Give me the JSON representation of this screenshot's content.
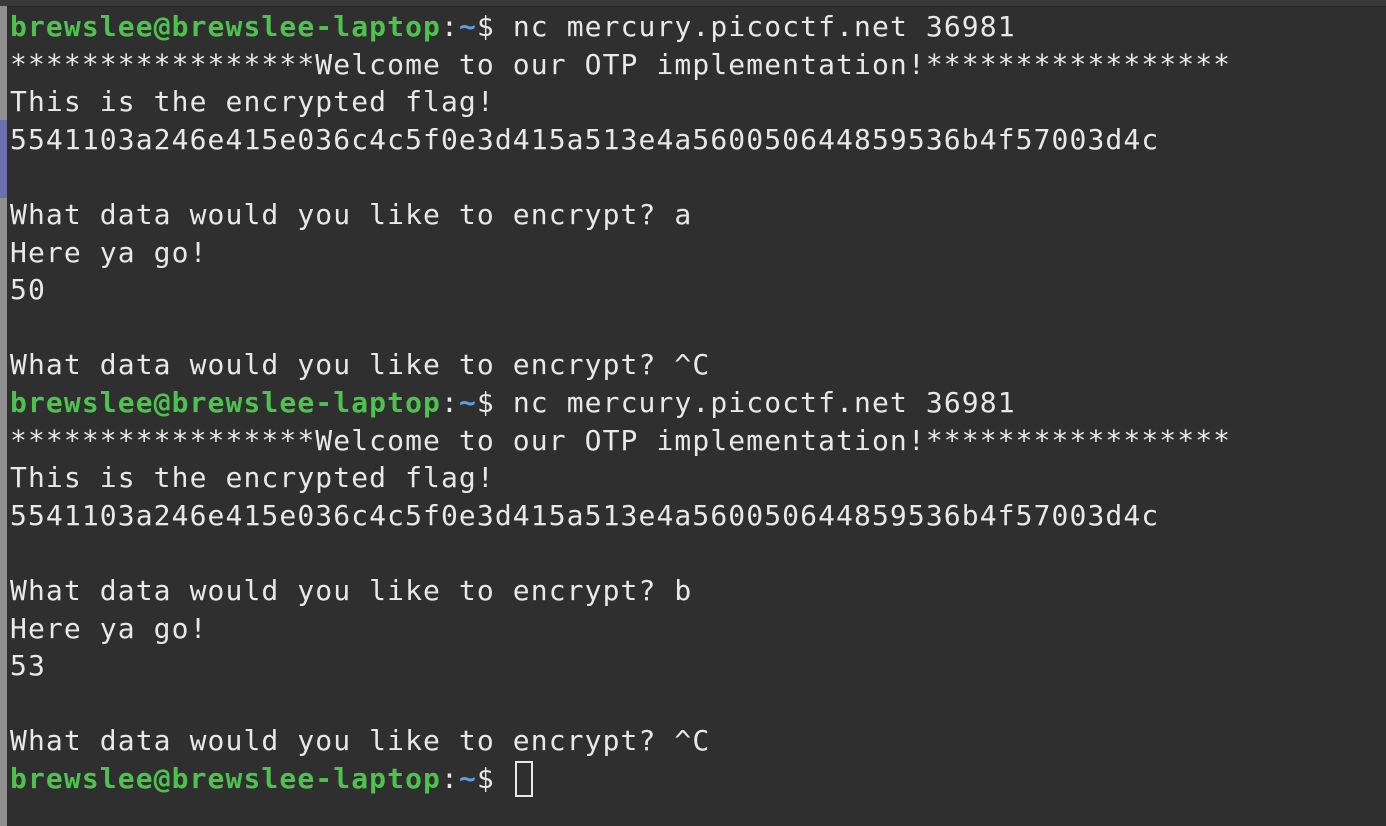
{
  "prompt": {
    "user": "brewslee@brewslee-laptop",
    "colon": ":",
    "path": "~",
    "dollar": "$ "
  },
  "lines": [
    {
      "type": "prompt",
      "cmd": "nc mercury.picoctf.net 36981"
    },
    {
      "type": "text",
      "text": "*****************Welcome to our OTP implementation!*****************"
    },
    {
      "type": "text",
      "text": "This is the encrypted flag!"
    },
    {
      "type": "text",
      "text": "5541103a246e415e036c4c5f0e3d415a513e4a560050644859536b4f57003d4c"
    },
    {
      "type": "text",
      "text": ""
    },
    {
      "type": "text",
      "text": "What data would you like to encrypt? a"
    },
    {
      "type": "text",
      "text": "Here ya go!"
    },
    {
      "type": "text",
      "text": "50"
    },
    {
      "type": "text",
      "text": ""
    },
    {
      "type": "text",
      "text": "What data would you like to encrypt? ^C"
    },
    {
      "type": "prompt",
      "cmd": "nc mercury.picoctf.net 36981"
    },
    {
      "type": "text",
      "text": "*****************Welcome to our OTP implementation!*****************"
    },
    {
      "type": "text",
      "text": "This is the encrypted flag!"
    },
    {
      "type": "text",
      "text": "5541103a246e415e036c4c5f0e3d415a513e4a560050644859536b4f57003d4c"
    },
    {
      "type": "text",
      "text": ""
    },
    {
      "type": "text",
      "text": "What data would you like to encrypt? b"
    },
    {
      "type": "text",
      "text": "Here ya go!"
    },
    {
      "type": "text",
      "text": "53"
    },
    {
      "type": "text",
      "text": ""
    },
    {
      "type": "text",
      "text": "What data would you like to encrypt? ^C"
    },
    {
      "type": "prompt",
      "cmd": "",
      "cursor": true
    }
  ],
  "colors": {
    "background": "#2f2f2f",
    "foreground": "#e8e8e8",
    "prompt_user": "#4ec24e",
    "prompt_path": "#5c9ee8"
  }
}
